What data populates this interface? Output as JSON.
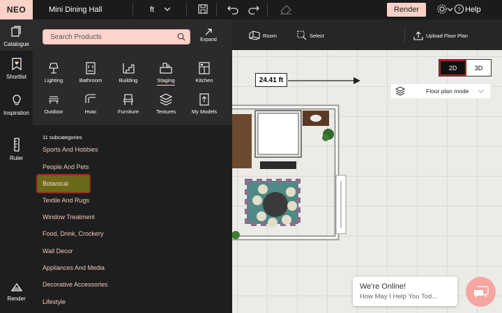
{
  "app": {
    "logo": "NEO",
    "project_title": "Mini Dining Hall",
    "unit": "ft",
    "render_label": "Render",
    "help_label": "Help"
  },
  "rail": {
    "items": [
      {
        "label": "Catalogue",
        "icon": "catalogue-icon"
      },
      {
        "label": "Shortlist",
        "icon": "shortlist-icon"
      },
      {
        "label": "Inspiration",
        "icon": "bulb-icon"
      },
      {
        "label": "Ruler",
        "icon": "ruler-icon"
      },
      {
        "label": "Render",
        "icon": "render-icon"
      }
    ]
  },
  "panel": {
    "search_placeholder": "Search Products",
    "expand_label": "Expand",
    "categories": [
      {
        "label": "Lighting"
      },
      {
        "label": "Bathroom"
      },
      {
        "label": "Building"
      },
      {
        "label": "Staging"
      },
      {
        "label": "Kitchen"
      },
      {
        "label": "Outdoor"
      },
      {
        "label": "Hvac"
      },
      {
        "label": "Furniture"
      },
      {
        "label": "Textures"
      },
      {
        "label": "My Models"
      }
    ],
    "active_category": "Staging",
    "subcategory_count": "11 subcategories",
    "subcategories": [
      "Sports And Hobbies",
      "People And Pets",
      "Botanical",
      "Textile And Rugs",
      "Window Treatment",
      "Food, Drink, Crockery",
      "Wall Decor",
      "Appliances And Media",
      "Decorative Accessories",
      "Lifestyle"
    ],
    "selected_subcategory": "Botanical"
  },
  "canvas_toolbar": {
    "room_label": "Room",
    "select_label": "Select",
    "upload_label": "Upload Floor Plan"
  },
  "view": {
    "mode_2d": "2D",
    "mode_3d": "3D",
    "active": "2D",
    "floor_plan_mode": "Floor plan mode"
  },
  "dimension_label": "24.41 ft",
  "chat": {
    "title": "We're Online!",
    "subtitle": "How May I Help You Tod..."
  },
  "colors": {
    "accent": "#fbd0c6",
    "highlight": "#6a6a18",
    "selection_border": "#9c2a1f",
    "chat": "#f6a5a0"
  }
}
